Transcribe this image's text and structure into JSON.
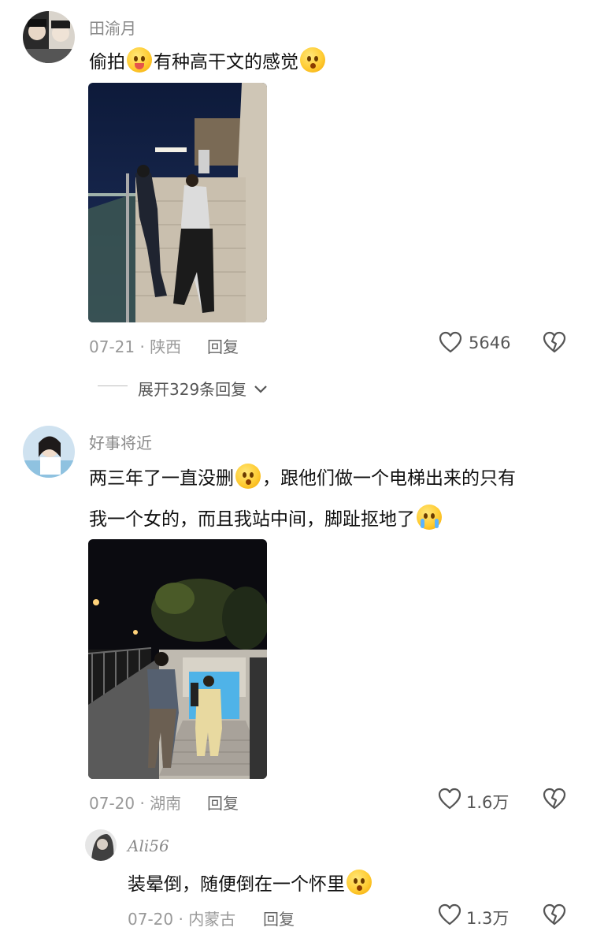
{
  "comment1": {
    "username": "田渝月",
    "text": "偷拍",
    "text2": "有种高干文的感觉",
    "date_loc": "07-21 · 陕西",
    "reply": "回复",
    "likes": "5646",
    "expand": "展开329条回复"
  },
  "comment2": {
    "username": "好事将近",
    "line1a": "两三年了一直没删",
    "line1b": "，跟他们做一个电梯出来的只有",
    "line2": "我一个女的，而且我站中间，脚趾抠地了",
    "date_loc": "07-20 · 湖南",
    "reply": "回复",
    "likes": "1.6万"
  },
  "subreply": {
    "username": "Ali56",
    "text": "装晕倒，随便倒在一个怀里",
    "date_loc": "07-20 · 内蒙古",
    "reply": "回复",
    "likes": "1.3万"
  },
  "icons": {
    "like": "heart-outline-icon",
    "dislike": "broken-heart-icon",
    "expand": "chevron-down-icon"
  },
  "colors": {
    "text": "#111111",
    "meta": "#999999",
    "username": "#8a8a8a"
  }
}
